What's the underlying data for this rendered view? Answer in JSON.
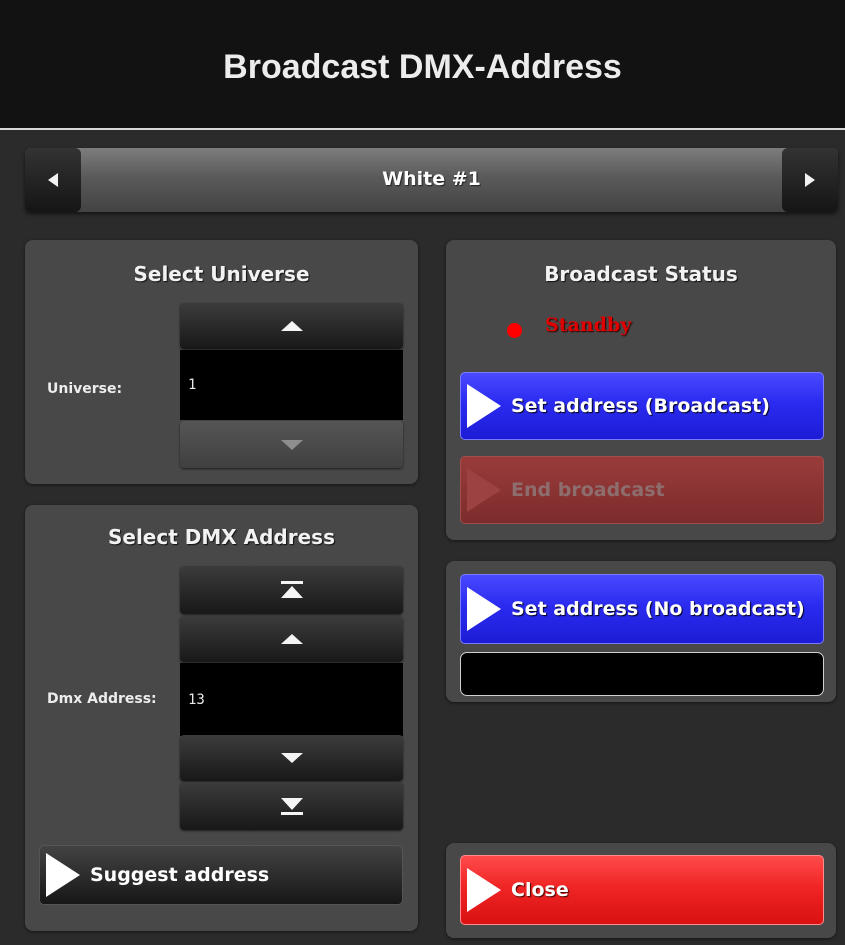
{
  "window": {
    "title": "Broadcast DMX-Address"
  },
  "fixture_selector": {
    "current": "White #1",
    "prev_icon": "triangle-left-icon",
    "next_icon": "triangle-right-icon"
  },
  "universe_panel": {
    "title": "Select Universe",
    "label": "Universe:",
    "value": "1",
    "up_icon": "triangle-up-icon",
    "down_icon": "triangle-down-icon"
  },
  "dmx_panel": {
    "title": "Select DMX Address",
    "label": "Dmx Address:",
    "value": "13",
    "first_icon": "skip-to-top-icon",
    "up_icon": "triangle-up-icon",
    "down_icon": "triangle-down-icon",
    "last_icon": "skip-to-bottom-icon",
    "suggest_label": "Suggest address"
  },
  "broadcast_panel": {
    "title": "Broadcast Status",
    "status": "Standby",
    "set_broadcast_label": "Set address (Broadcast)",
    "end_broadcast_label": "End broadcast"
  },
  "no_broadcast_panel": {
    "set_label": "Set address (No broadcast)",
    "message": ""
  },
  "close_label": "Close",
  "colors": {
    "background": "#2b2b2b",
    "title_bar": "#121212",
    "panel": "#484848",
    "primary_button": "#2b2bf0",
    "disabled_button": "#7c2c2c",
    "close_button": "#f02525",
    "status_red": "#ff0000"
  }
}
